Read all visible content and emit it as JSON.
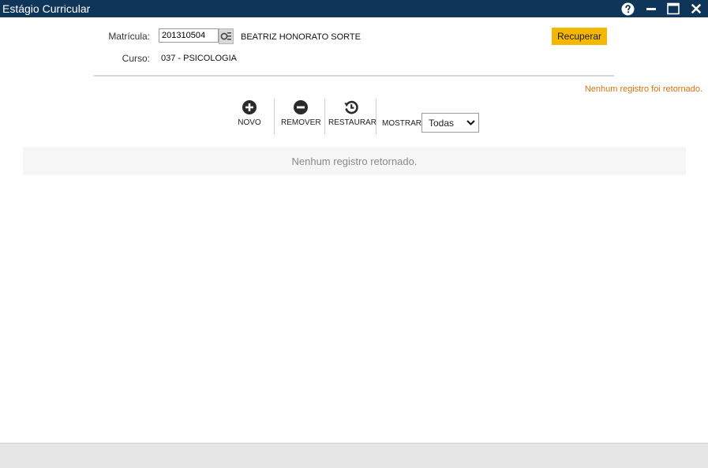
{
  "window": {
    "title": "Estágio Curricular",
    "controls": [
      "help-icon",
      "minimize-icon",
      "maximize-icon",
      "close-icon"
    ]
  },
  "form": {
    "matricula_label": "Matrícula:",
    "matricula_value": "201310504",
    "aluno_nome": "BEATRIZ HONORATO SORTE",
    "curso_label": "Curso:",
    "curso_value": "037 - PSICOLOGIA",
    "recuperar_label": "Recuperar"
  },
  "messages": {
    "top_notice": "Nenhum registro foi retornado.",
    "empty_list": "Nenhum registro retornado."
  },
  "toolbar": {
    "novo_label": "NOVO",
    "remover_label": "REMOVER",
    "restaurar_label": "RESTAURAR",
    "mostrar_label": "MOSTRAR:",
    "mostrar_value": "Todas"
  },
  "colors": {
    "titlebar": "#0f3558",
    "accent_button": "#f5b800",
    "notice_text": "#d9730d"
  }
}
